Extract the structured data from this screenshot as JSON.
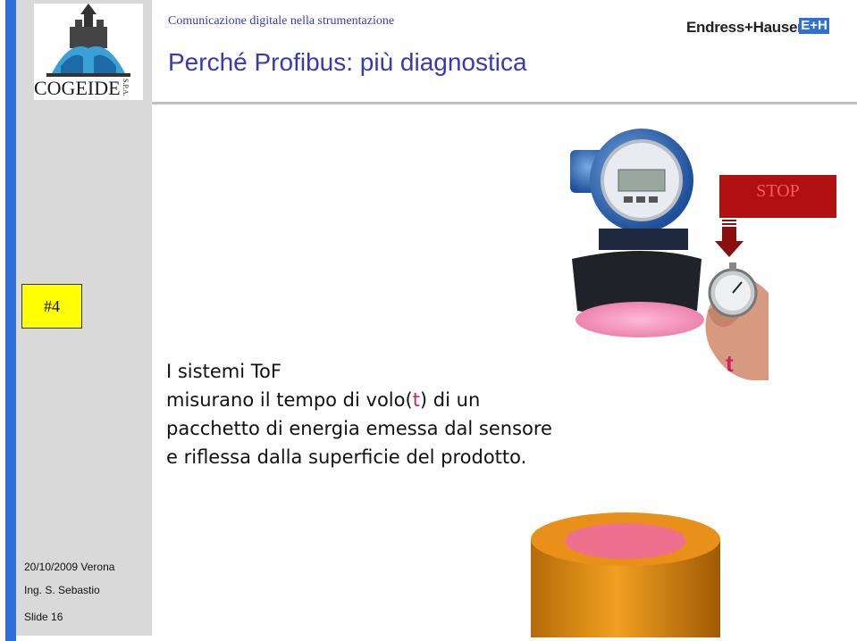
{
  "header": {
    "subtitle": "Comunicazione digitale nella strumentazione",
    "title": "Perché Profibus: più diagnostica",
    "brand_name": "Endress+Hauser",
    "brand_logo_text": "E+H"
  },
  "logo": {
    "text": "COGEIDE",
    "suffix": "S.P.A."
  },
  "slide_tag": "#4",
  "body": {
    "line1": "I sistemi ToF",
    "line2_before": "misurano il tempo di volo(",
    "line2_t": "t",
    "line2_after": ")  di un",
    "line3": "pacchetto di energia emessa dal sensore",
    "line4": "e riflessa dalla superficie del prodotto."
  },
  "stop_label": "STOP",
  "t_label": "t",
  "footer": {
    "date": "20/10/2009 Verona",
    "author": "Ing. S. Sebastio",
    "slide": "Slide 16"
  },
  "colors": {
    "accent_blue": "#2f6fd6",
    "title_blue": "#3a3ab0",
    "stop_red": "#b01010",
    "t_magenta": "#cc2266",
    "tag_yellow": "#ffff00"
  }
}
